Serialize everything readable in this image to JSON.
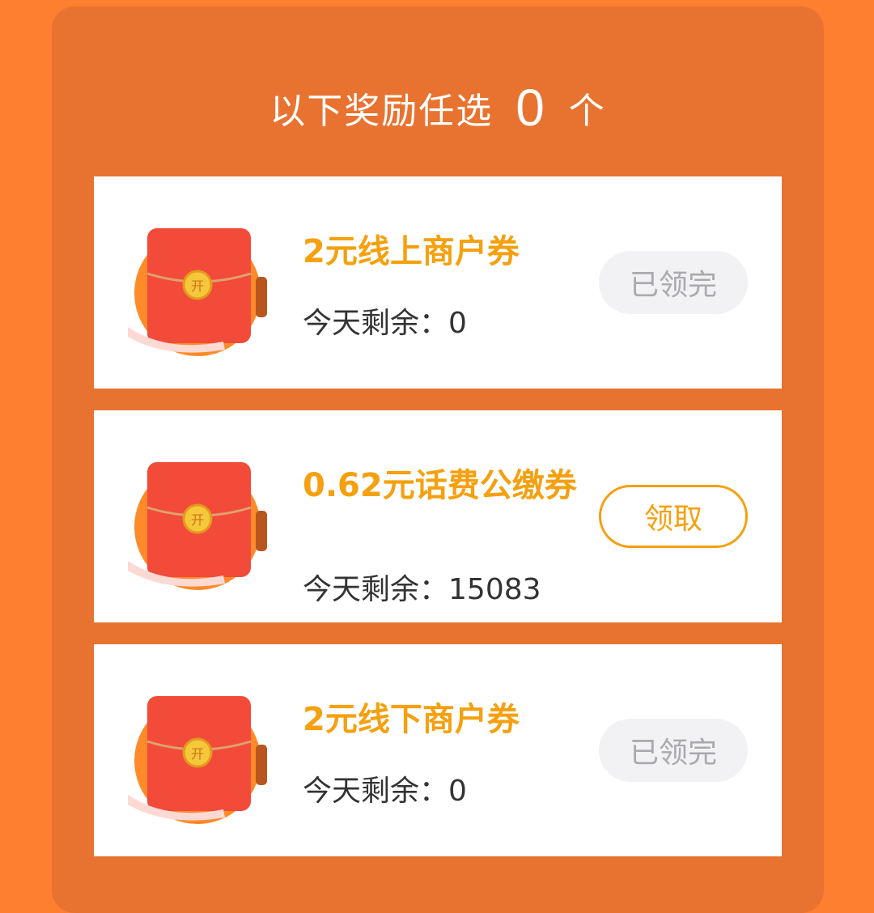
{
  "header": {
    "prefix": "以下奖励任选",
    "count": "0",
    "suffix": "个"
  },
  "rewards": [
    {
      "title": "2元线上商户券",
      "remain_label": "今天剩余：",
      "remain_value": "0",
      "button": "已领完",
      "button_state": "claimed"
    },
    {
      "title": "0.62元话费公缴券",
      "remain_label": "今天剩余：",
      "remain_value": "15083",
      "button": "领取",
      "button_state": "available"
    },
    {
      "title": "2元线下商户券",
      "remain_label": "今天剩余：",
      "remain_value": "0",
      "button": "已领完",
      "button_state": "claimed"
    }
  ],
  "packet_seal": "开",
  "colors": {
    "background": "#FF7F30",
    "panel": "#E87330",
    "accent": "#F5A00F",
    "packet": "#F24B3A"
  }
}
